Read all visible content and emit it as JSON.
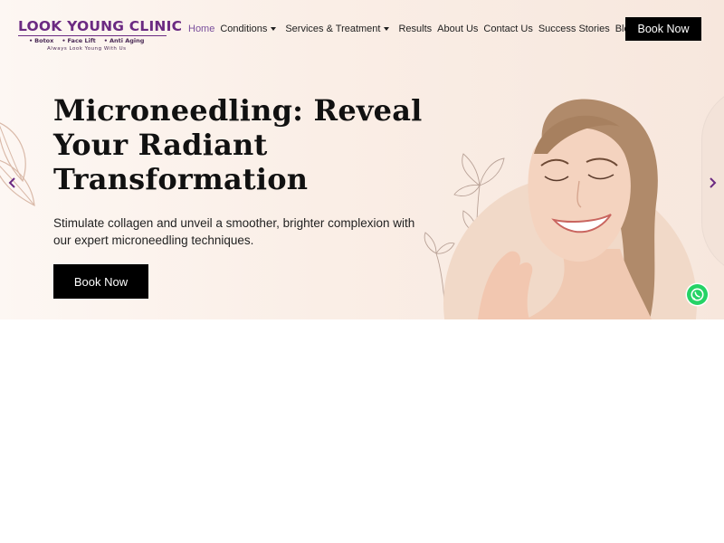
{
  "brand": {
    "name": "LOOK YOUNG CLINIC",
    "tags": [
      "Botox",
      "Face Lift",
      "Anti Aging"
    ],
    "slogan": "Always Look Young With Us",
    "color": "#6b2a82"
  },
  "nav": {
    "items": [
      {
        "label": "Home",
        "active": true
      },
      {
        "label": "Conditions",
        "dropdown": true
      },
      {
        "label": "Services & Treatment",
        "dropdown": true
      },
      {
        "label": "Results"
      },
      {
        "label": "About Us"
      },
      {
        "label": "Contact Us"
      },
      {
        "label": "Success Stories"
      },
      {
        "label": "Blogs"
      }
    ],
    "active_color": "#7a4f9c"
  },
  "header": {
    "book_label": "Book Now"
  },
  "hero": {
    "title_lines": [
      "Microneedling: Reveal",
      "Your Radiant",
      "Transformation"
    ],
    "subtitle": "Stimulate collagen and unveil a smoother, brighter complexion with our expert microneedling techniques.",
    "book_label": "Book Now",
    "prev_icon": "chevron-left-icon",
    "next_icon": "chevron-right-icon",
    "arrow_color": "#6b2a82",
    "background": "#faeee6"
  },
  "widgets": {
    "whatsapp_icon": "whatsapp-icon",
    "whatsapp_color": "#25d366"
  }
}
